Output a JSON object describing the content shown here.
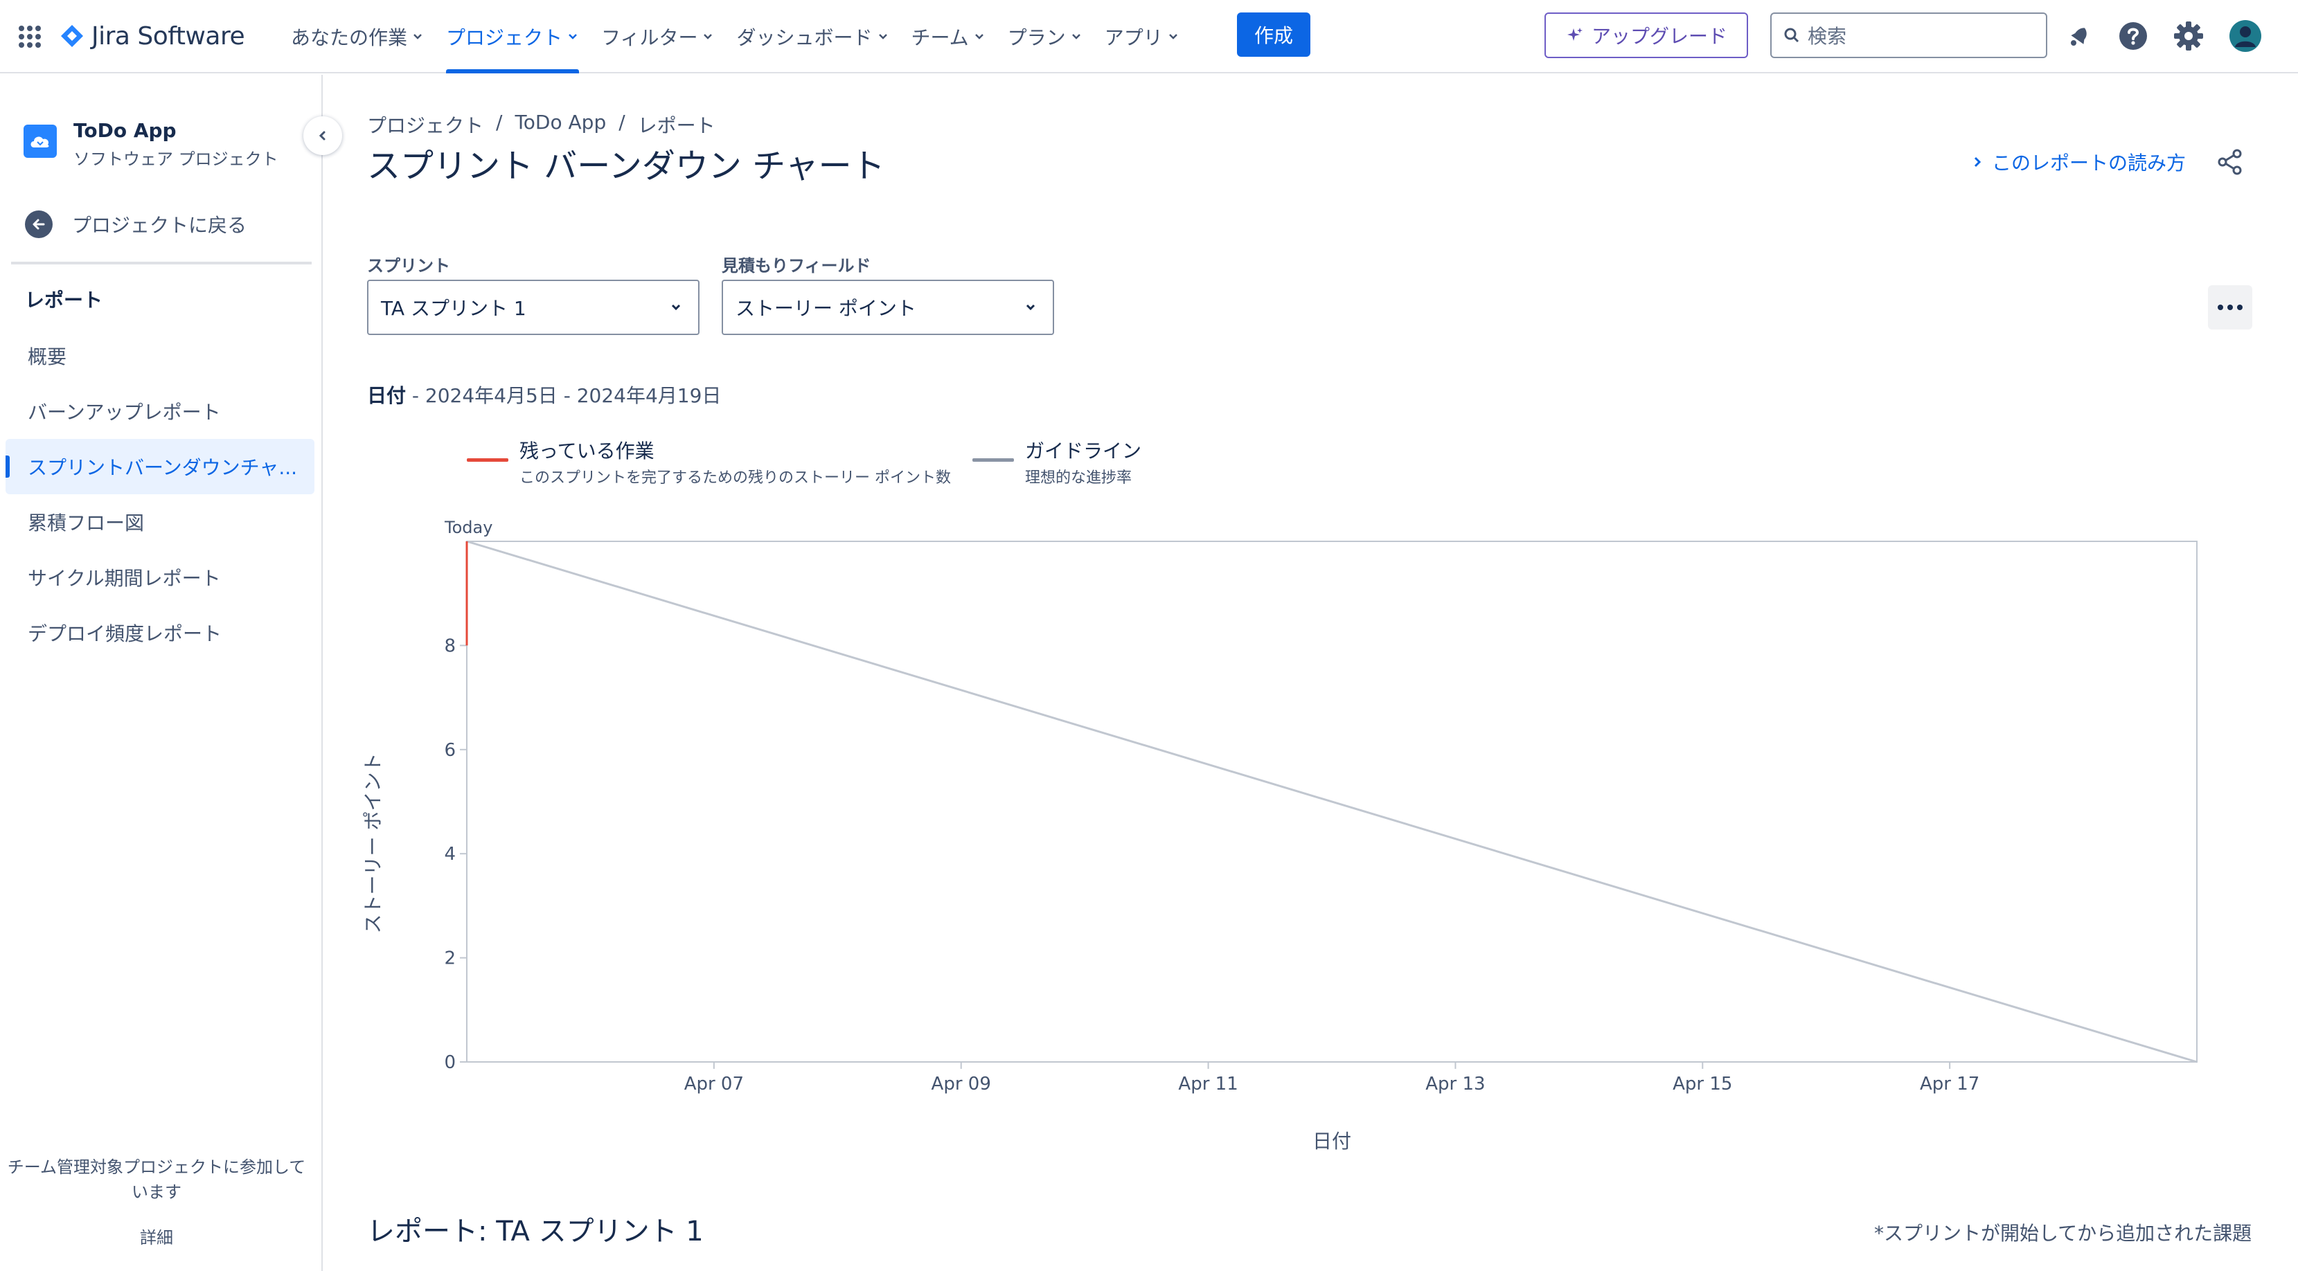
{
  "topnav": {
    "logo_text": "Jira Software",
    "items": [
      {
        "label": "あなたの作業",
        "active": false
      },
      {
        "label": "プロジェクト",
        "active": true
      },
      {
        "label": "フィルター",
        "active": false
      },
      {
        "label": "ダッシュボード",
        "active": false
      },
      {
        "label": "チーム",
        "active": false
      },
      {
        "label": "プラン",
        "active": false
      },
      {
        "label": "アプリ",
        "active": false
      }
    ],
    "create_label": "作成",
    "upgrade_label": "アップグレード",
    "search_placeholder": "検索",
    "icons": [
      "notifications-icon",
      "help-icon",
      "settings-icon",
      "profile-avatar-icon"
    ]
  },
  "sidebar": {
    "project_name": "ToDo App",
    "project_type": "ソフトウェア プロジェクト",
    "back_label": "プロジェクトに戻る",
    "section_title": "レポート",
    "items": [
      {
        "label": "概要",
        "active": false
      },
      {
        "label": "バーンアップレポート",
        "active": false
      },
      {
        "label": "スプリントバーンダウンチャ...",
        "active": true
      },
      {
        "label": "累積フロー図",
        "active": false
      },
      {
        "label": "サイクル期間レポート",
        "active": false
      },
      {
        "label": "デプロイ頻度レポート",
        "active": false
      }
    ],
    "footer_text_1": "チーム管理対象プロジェクトに参加して",
    "footer_text_2": "います",
    "footer_link": "詳細"
  },
  "main": {
    "breadcrumb": [
      "プロジェクト",
      "ToDo App",
      "レポート"
    ],
    "breadcrumb_sep": "/",
    "title": "スプリント バーンダウン チャート",
    "how_to_label": "このレポートの読み方",
    "sprint_label": "スプリント",
    "sprint_value": "TA スプリント 1",
    "estimate_label": "見積もりフィールド",
    "estimate_value": "ストーリー ポイント",
    "date_label": "日付",
    "date_range": " - 2024年4月5日 - 2024年4月19日",
    "report_title": "レポート: TA スプリント 1",
    "report_note": "*スプリントが開始してから追加された課題"
  },
  "chart_data": {
    "type": "line",
    "legend": [
      {
        "name": "残っている作業",
        "description": "このスプリントを完了するための残りのストーリー ポイント数",
        "color": "#e5493a"
      },
      {
        "name": "ガイドライン",
        "description": "理想的な進捗率",
        "color": "#8993a4"
      }
    ],
    "today_label": "Today",
    "xlabel": "日付",
    "ylabel": "ストーリー ポイント",
    "x_range": [
      "2024-04-05",
      "2024-04-19"
    ],
    "x_ticks": [
      "Apr 07",
      "Apr 09",
      "Apr 11",
      "Apr 13",
      "Apr 15",
      "Apr 17"
    ],
    "y_ticks": [
      0,
      2,
      4,
      6,
      8
    ],
    "ylim": [
      0,
      10
    ],
    "series": [
      {
        "name": "残っている作業",
        "color": "#e5493a",
        "points": [
          [
            "2024-04-05",
            10
          ],
          [
            "2024-04-05",
            8
          ]
        ]
      },
      {
        "name": "ガイドライン",
        "color": "#c1c7d0",
        "points": [
          [
            "2024-04-05",
            10
          ],
          [
            "2024-04-19",
            0
          ]
        ]
      }
    ]
  }
}
